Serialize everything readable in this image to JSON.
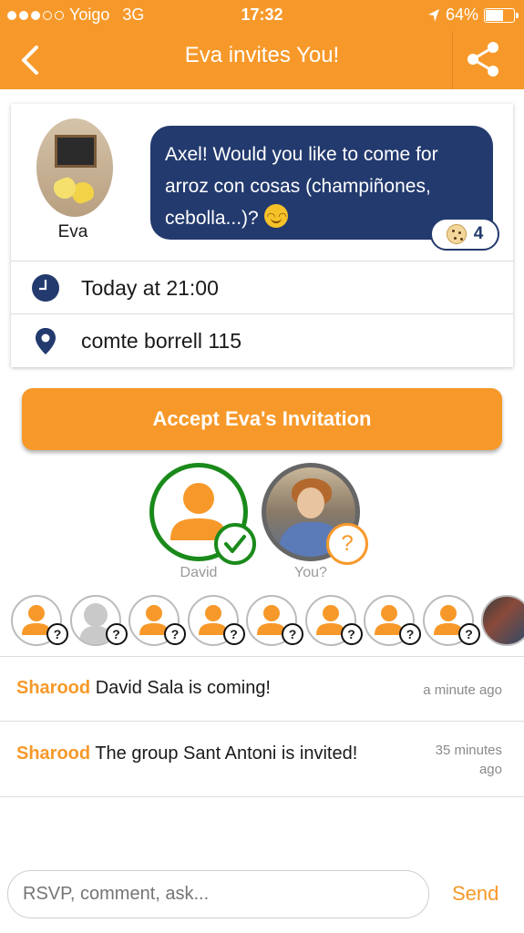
{
  "status": {
    "carrier": "Yoigo",
    "network": "3G",
    "time": "17:32",
    "battery": "64%",
    "battery_level": 0.64
  },
  "nav": {
    "title": "Eva invites You!",
    "back_icon": "chevron-left-icon",
    "share_icon": "share-icon"
  },
  "invite": {
    "host_name": "Eva",
    "message": "Axel! Would you like to come for arroz con cosas (champiñones, cebolla...)?",
    "cookies": "4",
    "time": "Today at 21:00",
    "place": "comte borrell 115"
  },
  "accept_label": "Accept Eva's Invitation",
  "participants": [
    {
      "label": "David",
      "state": "accepted"
    },
    {
      "label": "You?",
      "state": "pending"
    }
  ],
  "invitee_marker": "?",
  "activity": [
    {
      "source": "Sharood",
      "text": "David Sala is coming!",
      "time": "a minute ago"
    },
    {
      "source": "Sharood",
      "text": "The group  Sant Antoni is invited!",
      "time": "35 minutes ago"
    }
  ],
  "composer": {
    "placeholder": "RSVP, comment, ask...",
    "send_label": "Send"
  },
  "colors": {
    "accent": "#f7992a",
    "bubble": "#233a6e",
    "accepted": "#1a8a1a"
  }
}
